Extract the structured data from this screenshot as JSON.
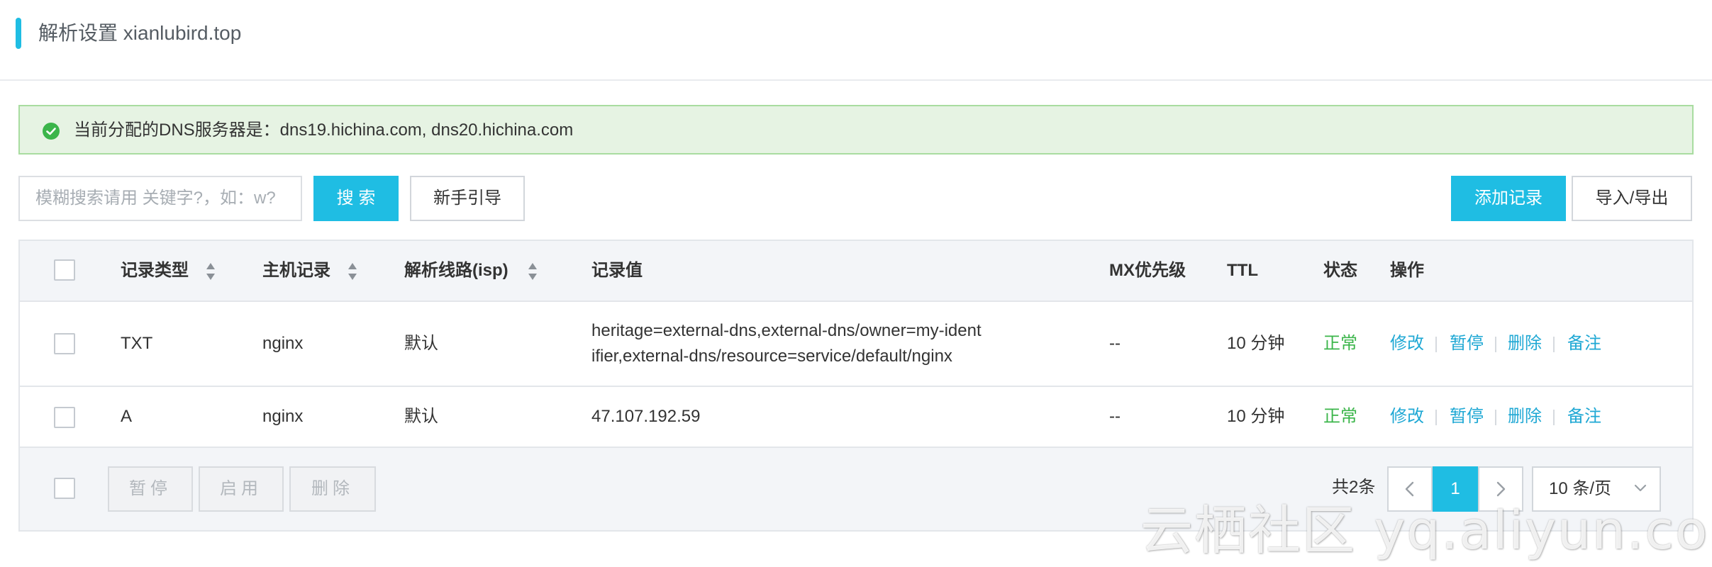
{
  "header": {
    "title": "解析设置 xianlubird.top"
  },
  "notice": {
    "text": "当前分配的DNS服务器是：dns19.hichina.com, dns20.hichina.com"
  },
  "toolbar": {
    "search_placeholder": "模糊搜索请用 关键字?，如：w?",
    "search_label": "搜 索",
    "guide_label": "新手引导",
    "add_label": "添加记录",
    "import_export_label": "导入/导出"
  },
  "table": {
    "headers": {
      "type": "记录类型",
      "host": "主机记录",
      "line": "解析线路(isp)",
      "value": "记录值",
      "mx": "MX优先级",
      "ttl": "TTL",
      "status": "状态",
      "ops": "操作"
    },
    "rows": [
      {
        "type": "TXT",
        "host": "nginx",
        "line": "默认",
        "value_line1": "heritage=external-dns,external-dns/owner=my-ident",
        "value_line2": "ifier,external-dns/resource=service/default/nginx",
        "mx": "--",
        "ttl": "10 分钟",
        "status": "正常"
      },
      {
        "type": "A",
        "host": "nginx",
        "line": "默认",
        "value_line1": "47.107.192.59",
        "mx": "--",
        "ttl": "10 分钟",
        "status": "正常"
      }
    ],
    "ops": {
      "edit": "修改",
      "pause": "暂停",
      "delete": "删除",
      "remark": "备注"
    }
  },
  "footer": {
    "pause_label": "暂停",
    "enable_label": "启用",
    "delete_label": "删除",
    "total": "共2条",
    "prev": "<",
    "current_page": "1",
    "next": ">",
    "page_size": "10 条/页"
  },
  "watermark": "云栖社区 yq.aliyun.com",
  "colors": {
    "accent": "#1fbde3",
    "success": "#3bb54a",
    "link": "#1fa8d4",
    "notice_bg": "#e6f3e3"
  },
  "icons": {
    "notice": "check-circle-icon",
    "sort": "sort-icon",
    "select": "chevron-down-icon"
  }
}
